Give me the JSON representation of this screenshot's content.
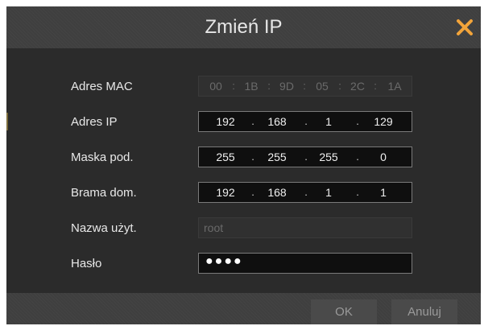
{
  "dialog": {
    "title": "Zmień IP",
    "close_icon": "close-icon",
    "accent": "#f2a43a"
  },
  "fields": {
    "mac": {
      "label": "Adres MAC",
      "values": [
        "00",
        "1B",
        "9D",
        "05",
        "2C",
        "1A"
      ],
      "separator": ":"
    },
    "ip": {
      "label": "Adres IP",
      "values": [
        "192",
        "168",
        "1",
        "129"
      ],
      "separator": "."
    },
    "mask": {
      "label": "Maska pod.",
      "values": [
        "255",
        "255",
        "255",
        "0"
      ],
      "separator": "."
    },
    "gateway": {
      "label": "Brama dom.",
      "values": [
        "192",
        "168",
        "1",
        "1"
      ],
      "separator": "."
    },
    "user": {
      "label": "Nazwa użyt.",
      "value": "root"
    },
    "password": {
      "label": "Hasło",
      "value": "●●●●"
    }
  },
  "buttons": {
    "ok": "OK",
    "cancel": "Anuluj"
  }
}
